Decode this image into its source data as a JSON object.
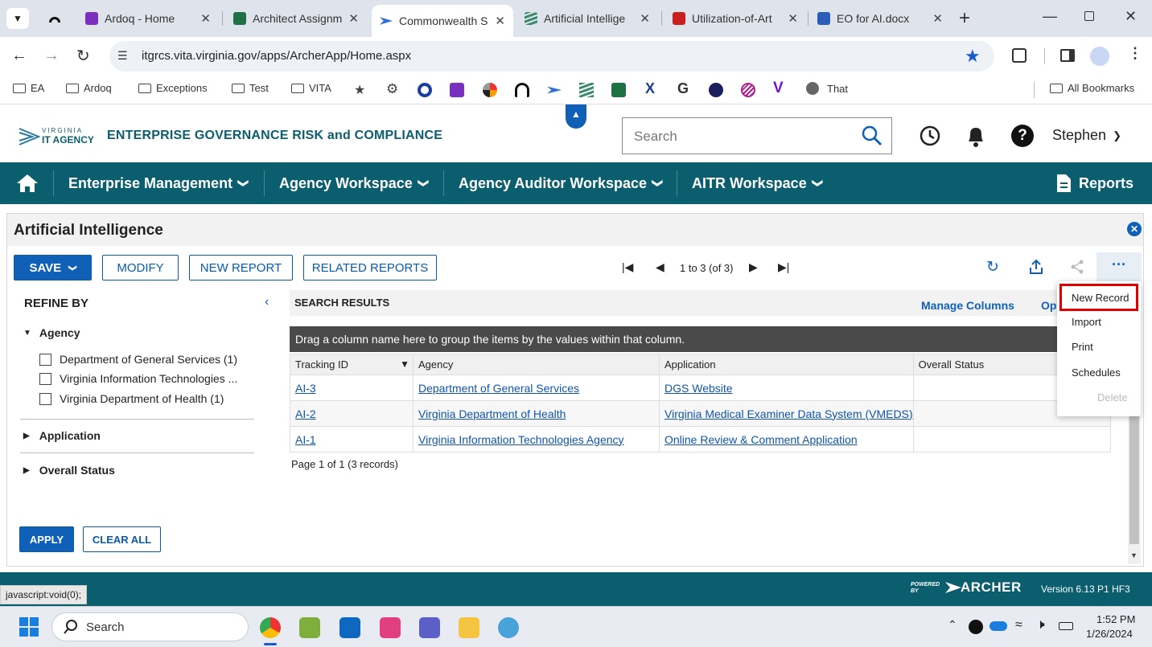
{
  "browser": {
    "tabs": [
      {
        "label": "Ardoq - Home",
        "icon": "ardoq-icon",
        "color": "#7b2fbf"
      },
      {
        "label": "Architect Assignm",
        "icon": "excel-icon",
        "color": "#1e7145"
      },
      {
        "label": "Commonwealth S",
        "icon": "archer-icon",
        "color": "#2f6fd0"
      },
      {
        "label": "Artificial Intellige",
        "icon": "archer-icon",
        "color": "#3a8a6e"
      },
      {
        "label": "Utilization-of-Art",
        "icon": "pdf-icon",
        "color": "#c8201e"
      },
      {
        "label": "EO for AI.docx",
        "icon": "word-icon",
        "color": "#2b5db8"
      }
    ],
    "url": "itgrcs.vita.virginia.gov/apps/ArcherApp/Home.aspx",
    "bookmarks": [
      "EA",
      "Ardoq",
      "Exceptions",
      "Test",
      "VITA",
      "That"
    ],
    "all_bookmarks": "All Bookmarks",
    "status_url": "javascript:void(0);"
  },
  "app": {
    "logo_top": "VIRGINIA",
    "logo_bottom": "IT AGENCY",
    "title": "ENTERPRISE GOVERNANCE RISK and COMPLIANCE",
    "search_placeholder": "Search",
    "user": "Stephen",
    "nav": [
      "Enterprise Management",
      "Agency Workspace",
      "Agency Auditor Workspace",
      "AITR Workspace"
    ],
    "reports": "Reports"
  },
  "panel": {
    "title": "Artificial Intelligence",
    "buttons": {
      "save": "SAVE",
      "modify": "MODIFY",
      "new_report": "NEW REPORT",
      "related_reports": "RELATED REPORTS"
    },
    "pager": "1 to 3 (of 3)",
    "refine_by": "REFINE BY",
    "facets": {
      "agency": "Agency",
      "agency_options": [
        "Department of General Services (1)",
        "Virginia Information Technologies ...",
        "Virginia Department of Health (1)"
      ],
      "application": "Application",
      "overall_status": "Overall Status"
    },
    "apply": "APPLY",
    "clear_all": "CLEAR ALL",
    "search_results": "SEARCH RESULTS",
    "manage_columns": "Manage Columns",
    "options_partial": "Opt",
    "group_hint": "Drag a column name here to group the items by the values within that column.",
    "columns": [
      "Tracking ID",
      "Agency",
      "Application",
      "Overall Status"
    ],
    "rows": [
      {
        "id": "AI-3",
        "agency": "Department of General Services",
        "application": "DGS Website",
        "status": ""
      },
      {
        "id": "AI-2",
        "agency": "Virginia Department of Health",
        "application": "Virginia Medical Examiner Data System (VMEDS)",
        "status": ""
      },
      {
        "id": "AI-1",
        "agency": "Virginia Information Technologies Agency",
        "application": "Online Review & Comment Application",
        "status": ""
      }
    ],
    "page_info": "Page 1 of 1 (3 records)",
    "menu": [
      "New Record",
      "Import",
      "Print",
      "Schedules",
      "Delete"
    ]
  },
  "footer": {
    "powered_by": "POWERED BY",
    "brand": "ARCHER",
    "version": "Version 6.13 P1 HF3"
  },
  "taskbar": {
    "search": "Search",
    "time": "1:52 PM",
    "date": "1/26/2024"
  },
  "colors": {
    "nav": "#0a5e6e",
    "accent": "#1060b8",
    "highlight": "#e00000"
  }
}
